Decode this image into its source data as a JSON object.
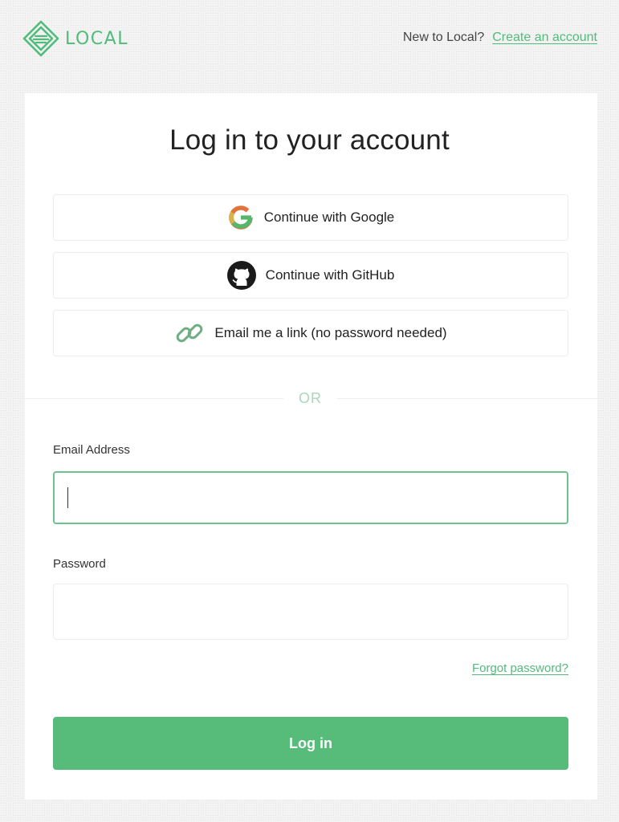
{
  "brand": {
    "name": "LOCAL",
    "color": "#51bb7b"
  },
  "header": {
    "signup_prompt": "New to Local?",
    "signup_link": "Create an account"
  },
  "login": {
    "title": "Log in to your account",
    "oauth": {
      "google_label": "Continue with Google",
      "github_label": "Continue with GitHub",
      "email_link_label": "Email me a link (no password needed)"
    },
    "divider_text": "OR",
    "email": {
      "label": "Email Address",
      "value": ""
    },
    "password": {
      "label": "Password",
      "value": ""
    },
    "forgot_label": "Forgot password?",
    "submit_label": "Log in",
    "submit_color": "#57bb79"
  },
  "icons": [
    "local-logo-icon",
    "google-icon",
    "github-icon",
    "link-icon"
  ]
}
